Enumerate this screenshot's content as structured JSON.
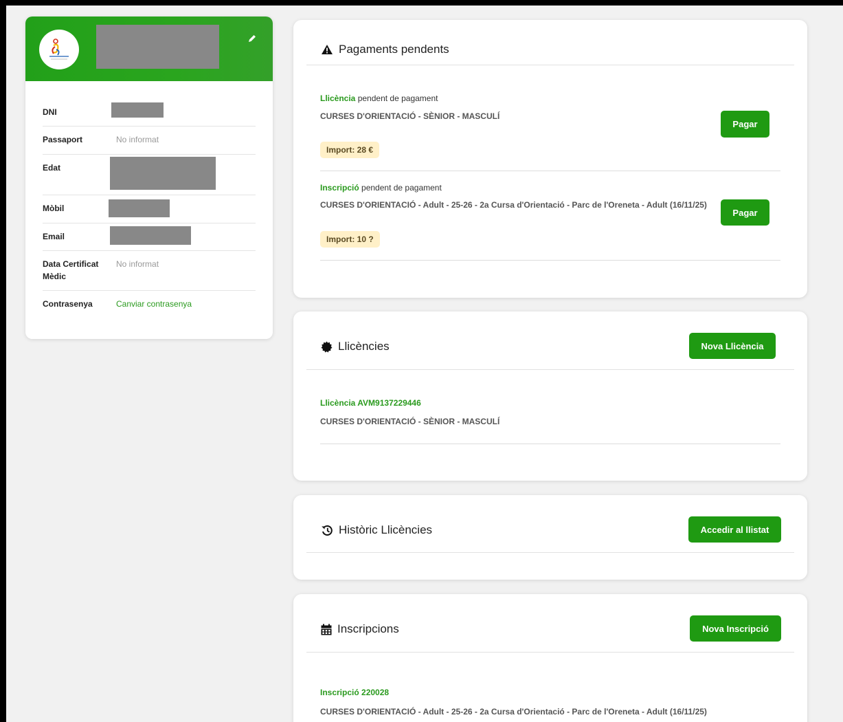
{
  "profile": {
    "fields": [
      {
        "label": "DNI",
        "value": ""
      },
      {
        "label": "Passaport",
        "value": "No informat"
      },
      {
        "label": "Edat",
        "value": ""
      },
      {
        "label": "Mòbil",
        "value": ""
      },
      {
        "label": "Email",
        "value": ""
      },
      {
        "label": "Data Certificat Mèdic",
        "value": "No informat"
      },
      {
        "label": "Contrasenya",
        "value": "Canviar contrasenya"
      }
    ]
  },
  "pending_payments": {
    "title": "Pagaments pendents",
    "items": [
      {
        "type": "Llicència",
        "status": "pendent de pagament",
        "description": "CURSES D'ORIENTACIÓ - SÈNIOR - MASCULÍ",
        "amount": "Import: 28 €",
        "button": "Pagar"
      },
      {
        "type": "Inscripció",
        "status": "pendent de pagament",
        "description": "CURSES D'ORIENTACIÓ - Adult - 25-26 - 2a Cursa d'Orientació - Parc de l'Oreneta - Adult (16/11/25)",
        "amount": "Import: 10 ?",
        "button": "Pagar"
      }
    ]
  },
  "licenses": {
    "title": "Llicències",
    "button": "Nova Llicència",
    "items": [
      {
        "code": "Llicència AVM9137229446",
        "description": "CURSES D'ORIENTACIÓ - SÈNIOR - MASCULÍ"
      }
    ]
  },
  "license_history": {
    "title": "Històric Llicències",
    "button": "Accedir al llistat"
  },
  "registrations": {
    "title": "Inscripcions",
    "button": "Nova Inscripció",
    "items": [
      {
        "code": "Inscripció 220028",
        "description": "CURSES D'ORIENTACIÓ - Adult - 25-26 - 2a Cursa d'Orientació - Parc de l'Oreneta - Adult (16/11/25)"
      }
    ]
  },
  "colors": {
    "accent": "#1f9a12",
    "header": "#22a019",
    "badge": "#fff0c8"
  },
  "icons": [
    "pencil-icon",
    "warning-icon",
    "badge-icon",
    "history-icon",
    "calendar-icon"
  ]
}
